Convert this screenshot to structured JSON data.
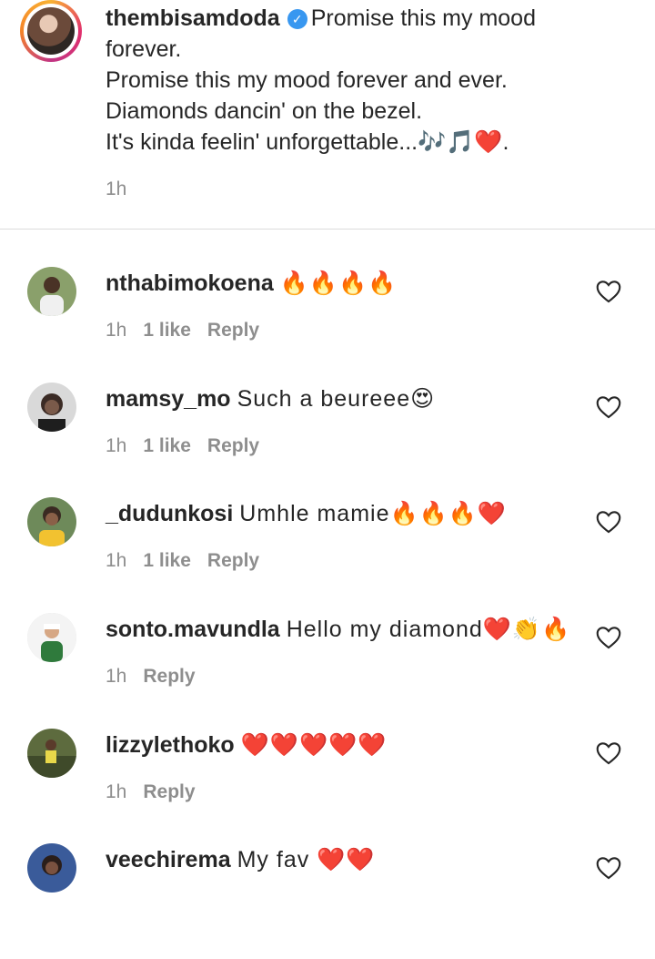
{
  "caption": {
    "username": "thembisamdoda",
    "verified": true,
    "lines": [
      "Promise this my mood",
      "forever.",
      "Promise this my mood forever and ever.",
      "Diamonds dancin' on the bezel.",
      "It's kinda feelin' unforgettable...🎶🎵❤️."
    ],
    "time": "1h"
  },
  "comments": [
    {
      "username": "nthabimokoena",
      "text": "🔥🔥🔥🔥",
      "time": "1h",
      "likes": "1 like",
      "reply": "Reply"
    },
    {
      "username": "mamsy_mo",
      "text": "Such a beureee😍",
      "time": "1h",
      "likes": "1 like",
      "reply": "Reply"
    },
    {
      "username": "_dudunkosi",
      "text": "Umhle mamie🔥🔥🔥❤️",
      "time": "1h",
      "likes": "1 like",
      "reply": "Reply"
    },
    {
      "username": "sonto.mavundla",
      "text": "Hello my diamond❤️👏🔥",
      "time": "1h",
      "likes": "",
      "reply": "Reply"
    },
    {
      "username": "lizzylethoko",
      "text": "❤️❤️❤️❤️❤️",
      "time": "1h",
      "likes": "",
      "reply": "Reply"
    },
    {
      "username": "veechirema",
      "text": "My fav ❤️❤️",
      "time": "",
      "likes": "",
      "reply": ""
    }
  ],
  "icons": {
    "verified": "verified-badge-icon",
    "like": "heart-outline-icon"
  },
  "colors": {
    "text": "#262626",
    "meta": "#8e8e8e",
    "verified": "#3897f0",
    "divider": "#dbdbdb"
  }
}
